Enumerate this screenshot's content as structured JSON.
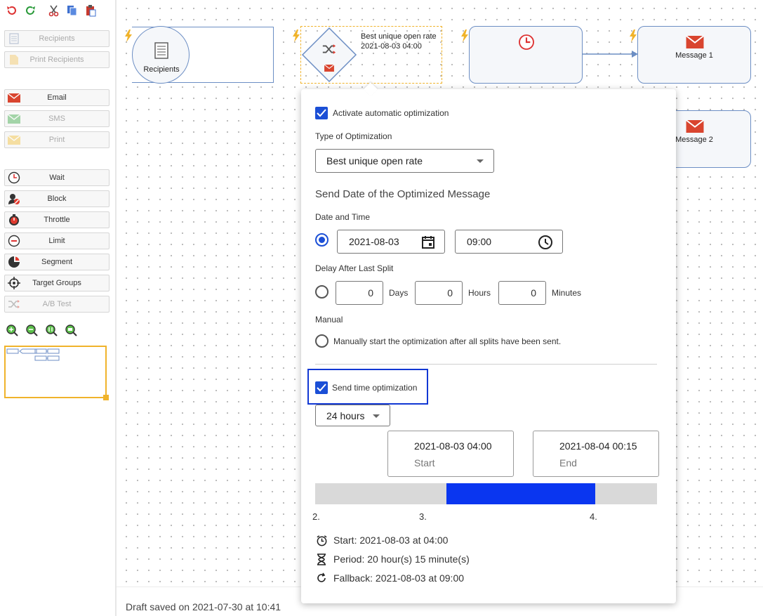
{
  "toolbar": {
    "undo_icon": "undo-icon",
    "redo_icon": "redo-icon",
    "cut_icon": "scissors-icon",
    "copy_icon": "copy-icon",
    "paste_icon": "paste-icon"
  },
  "sidebar": {
    "groups": [
      {
        "label": "Recipients",
        "icon": "recipients-list-icon",
        "disabled": true
      },
      {
        "label": "Print Recipients",
        "icon": "print-recipients-icon",
        "disabled": true
      },
      {
        "label": "Email",
        "icon": "envelope-icon",
        "disabled": false
      },
      {
        "label": "SMS",
        "icon": "sms-icon",
        "disabled": true
      },
      {
        "label": "Print",
        "icon": "print-icon",
        "disabled": true
      },
      {
        "label": "Wait",
        "icon": "clock-icon",
        "disabled": false
      },
      {
        "label": "Block",
        "icon": "block-icon",
        "disabled": false
      },
      {
        "label": "Throttle",
        "icon": "stopwatch-icon",
        "disabled": false
      },
      {
        "label": "Limit",
        "icon": "minus-circle-icon",
        "disabled": false
      },
      {
        "label": "Segment",
        "icon": "pie-segment-icon",
        "disabled": false
      },
      {
        "label": "Target Groups",
        "icon": "crosshair-icon",
        "disabled": false
      },
      {
        "label": "A/B Test",
        "icon": "shuffle-icon",
        "disabled": true
      }
    ],
    "zoom_icons": [
      "zoom-in-icon",
      "zoom-out-icon",
      "zoom-actual-icon",
      "zoom-fit-icon"
    ]
  },
  "canvas": {
    "nodes": {
      "recipients": {
        "label": "Recipients"
      },
      "split": {
        "line1": "Best unique open rate",
        "line2": "2021-08-03 04:00"
      },
      "message1": {
        "label": "Message 1"
      },
      "message2": {
        "label": "Message 2"
      }
    }
  },
  "popup": {
    "activate_label": "Activate automatic optimization",
    "activate_checked": true,
    "type_label": "Type of Optimization",
    "type_value": "Best unique open rate",
    "send_date_heading": "Send Date of the Optimized Message",
    "date_time_label": "Date and Time",
    "date_value": "2021-08-03",
    "time_value": "09:00",
    "delay_label": "Delay After Last Split",
    "delay_days": "0",
    "days_unit": "Days",
    "delay_hours": "0",
    "hours_unit": "Hours",
    "delay_minutes": "0",
    "minutes_unit": "Minutes",
    "manual_label": "Manual",
    "manual_text": "Manually start the optimization after all splits have been sent.",
    "send_time_label": "Send time optimization",
    "send_time_checked": true,
    "window_value": "24 hours",
    "start_value": "2021-08-03 04:00",
    "start_caption": "Start",
    "end_value": "2021-08-04 00:15",
    "end_caption": "End",
    "timeline": {
      "window_start_fraction": 0.385,
      "window_end_fraction": 0.82
    },
    "ticks": [
      "2.",
      "3.",
      "4."
    ],
    "info": {
      "start": "Start: 2021-08-03 at 04:00",
      "period": "Period: 20 hour(s) 15 minute(s)",
      "fallback": "Fallback: 2021-08-03 at 09:00"
    }
  },
  "status": {
    "draft": "Draft saved on 2021-07-30 at 10:41"
  },
  "colors": {
    "accent": "#1b4fd6",
    "timeline_fill": "#0a36f0",
    "node_border": "#6c8ec4",
    "selection": "#f0b32b",
    "email_red": "#d9452f"
  }
}
